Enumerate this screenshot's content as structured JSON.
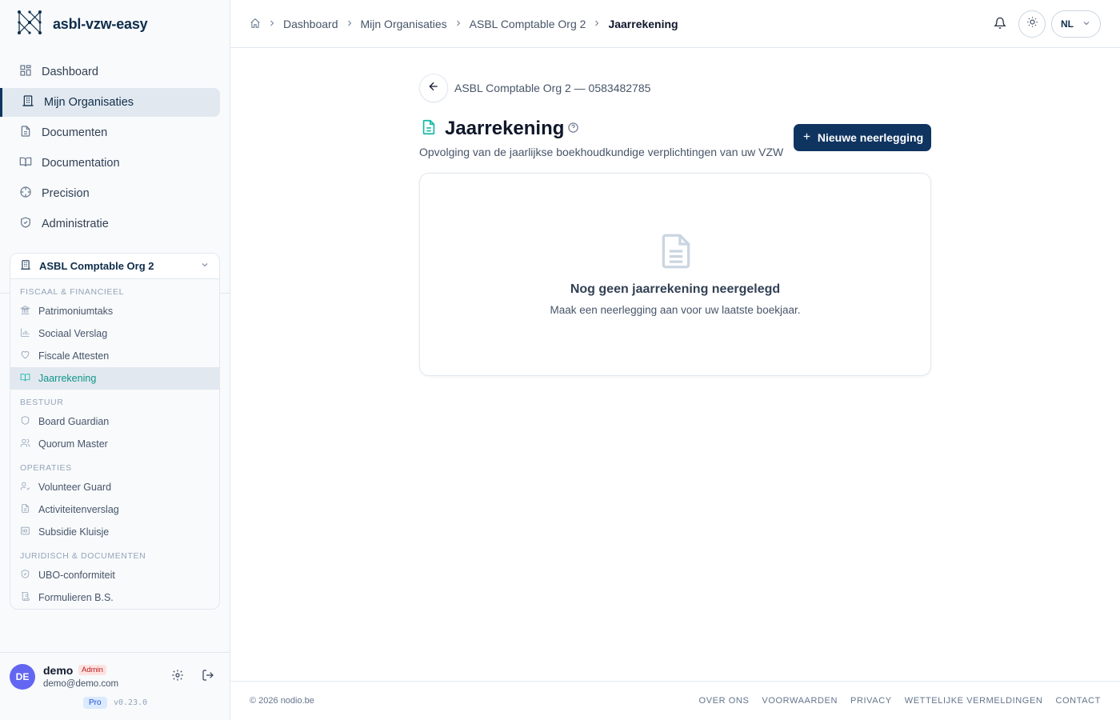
{
  "brand": {
    "name": "asbl-vzw-easy"
  },
  "nav": {
    "items": [
      {
        "label": "Dashboard"
      },
      {
        "label": "Mijn Organisaties"
      },
      {
        "label": "Documenten"
      },
      {
        "label": "Documentation"
      },
      {
        "label": "Precision"
      },
      {
        "label": "Administratie"
      }
    ]
  },
  "org": {
    "name": "ASBL Comptable Org 2",
    "groups": [
      {
        "label": "FISCAAL & FINANCIEEL",
        "items": [
          "Patrimoniumtaks",
          "Sociaal Verslag",
          "Fiscale Attesten",
          "Jaarrekening"
        ]
      },
      {
        "label": "BESTUUR",
        "items": [
          "Board Guardian",
          "Quorum Master"
        ]
      },
      {
        "label": "OPERATIES",
        "items": [
          "Volunteer Guard",
          "Activiteitenverslag",
          "Subsidie Kluisje"
        ]
      },
      {
        "label": "JURIDISCH & DOCUMENTEN",
        "items": [
          "UBO-conformiteit",
          "Formulieren B.S."
        ]
      }
    ]
  },
  "user": {
    "initials": "DE",
    "name": "demo",
    "role": "Admin",
    "email": "demo@demo.com",
    "plan": "Pro",
    "version": "v0.23.0"
  },
  "breadcrumb": {
    "items": [
      "Dashboard",
      "Mijn Organisaties",
      "ASBL Comptable Org 2"
    ],
    "current": "Jaarrekening"
  },
  "topbar": {
    "language": "NL"
  },
  "page": {
    "org_line": "ASBL Comptable Org 2 — 0583482785",
    "title": "Jaarrekening",
    "subtitle": "Opvolging van de jaarlijkse boekhoudkundige verplichtingen van uw VZW",
    "new_button": "Nieuwe neerlegging",
    "empty_title": "Nog geen jaarrekening neergelegd",
    "empty_text": "Maak een neerlegging aan voor uw laatste boekjaar."
  },
  "footer": {
    "copyright": "© 2026 nodio.be",
    "links": [
      "OVER ONS",
      "VOORWAARDEN",
      "PRIVACY",
      "WETTELIJKE VERMELDINGEN",
      "CONTACT"
    ]
  },
  "colors": {
    "brand_navy": "#0f3460",
    "accent_teal": "#14b8a6",
    "avatar": "#6366f1"
  }
}
